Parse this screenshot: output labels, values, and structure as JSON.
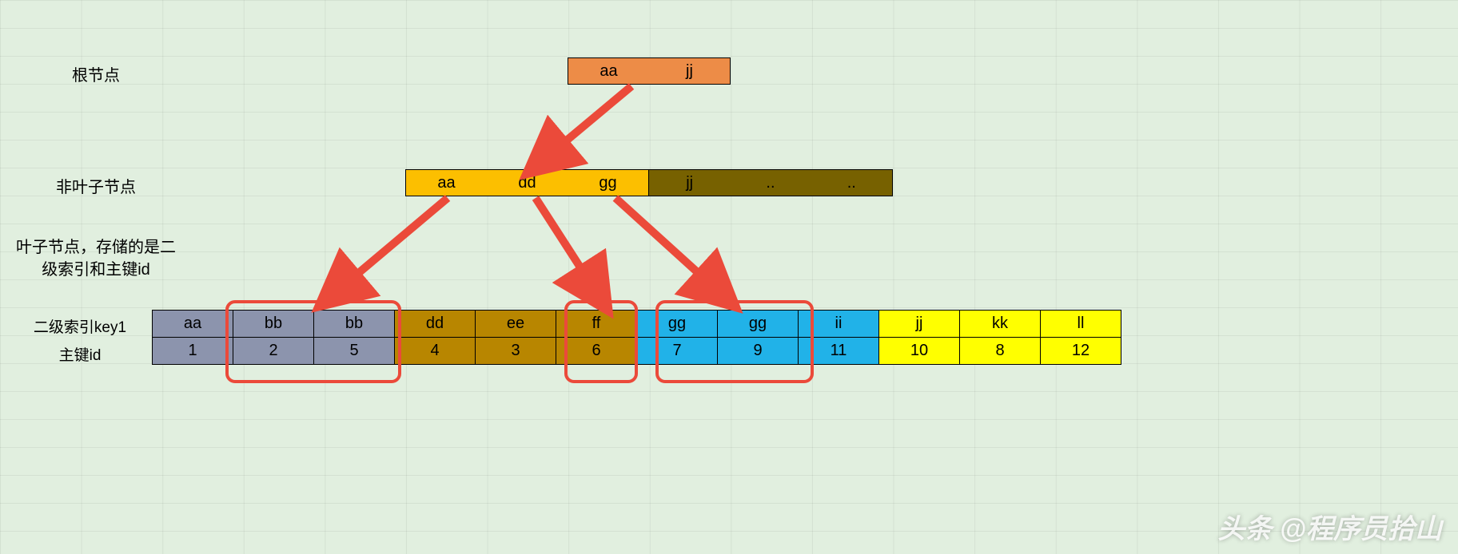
{
  "labels": {
    "root": "根节点",
    "mid": "非叶子节点",
    "leaf_desc": "叶子节点，存储的是二级索引和主键id",
    "row_key": "二级索引key1",
    "row_id": "主键id"
  },
  "root_node": [
    "aa",
    "jj"
  ],
  "mid_left": [
    "aa",
    "dd",
    "gg"
  ],
  "mid_right": [
    "jj",
    "..",
    ".."
  ],
  "leaf": {
    "keys": [
      "aa",
      "bb",
      "bb",
      "dd",
      "ee",
      "ff",
      "gg",
      "gg",
      "ii",
      "jj",
      "kk",
      "ll"
    ],
    "ids": [
      "1",
      "2",
      "5",
      "4",
      "3",
      "6",
      "7",
      "9",
      "11",
      "10",
      "8",
      "12"
    ],
    "groups": [
      1,
      1,
      1,
      2,
      2,
      2,
      3,
      3,
      3,
      4,
      4,
      4
    ]
  },
  "watermark": "头条 @程序员拾山"
}
